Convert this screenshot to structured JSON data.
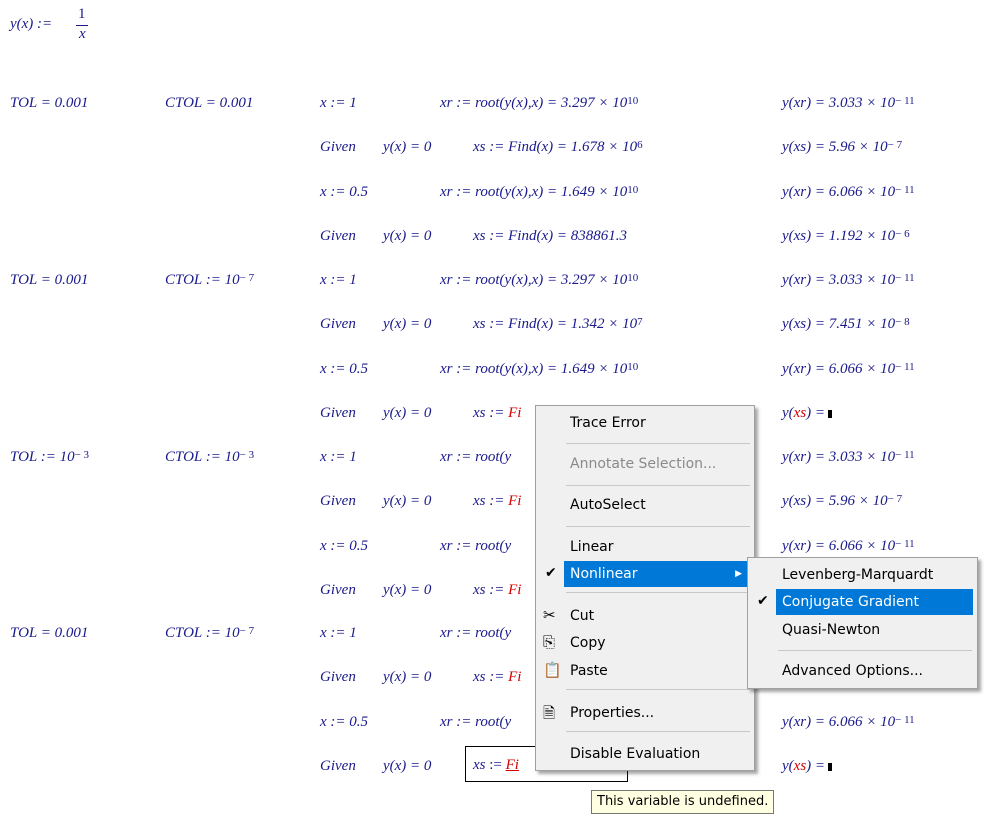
{
  "definition": {
    "lhs": "y(x) :=",
    "numerator": "1",
    "denominator": "x"
  },
  "blocks": [
    {
      "tol": "TOL = 0.001",
      "ctol": "CTOL = 0.001",
      "rows": [
        {
          "a": "x := 1",
          "b": "xr := root(y(x),x) = 3.297 × 10",
          "b_exp": "10",
          "c": "y(xr) = 3.033 × 10",
          "c_exp": "− 11"
        },
        {
          "a": "Given",
          "a2": "y(x) = 0",
          "b": "xs := Find(x) = 1.678 × 10",
          "b_exp": "6",
          "c": "y(xs) = 5.96 × 10",
          "c_exp": "− 7"
        },
        {
          "a": "x := 0.5",
          "b": "xr := root(y(x),x) = 1.649 × 10",
          "b_exp": "10",
          "c": "y(xr) = 6.066 × 10",
          "c_exp": "− 11"
        },
        {
          "a": "Given",
          "a2": "y(x) = 0",
          "b": "xs := Find(x) = 838861.3",
          "b_exp": "",
          "c": "y(xs) = 1.192 × 10",
          "c_exp": "− 6"
        }
      ]
    },
    {
      "tol": "TOL = 0.001",
      "ctol": "CTOL := 10",
      "ctol_exp": "− 7",
      "rows": [
        {
          "a": "x := 1",
          "b": "xr := root(y(x),x) = 3.297 × 10",
          "b_exp": "10",
          "c": "y(xr) = 3.033 × 10",
          "c_exp": "− 11"
        },
        {
          "a": "Given",
          "a2": "y(x) = 0",
          "b": "xs := Find(x) = 1.342 × 10",
          "b_exp": "7",
          "c": "y(xs) = 7.451 × 10",
          "c_exp": "− 8"
        },
        {
          "a": "x := 0.5",
          "b": "xr := root(y(x),x) = 1.649 × 10",
          "b_exp": "10",
          "c": "y(xr) = 6.066 × 10",
          "c_exp": "− 11"
        },
        {
          "a": "Given",
          "a2": "y(x) = 0",
          "b": "xs := Fi",
          "b_exp": "",
          "c": "y(xs) =",
          "c_exp": ""
        }
      ]
    },
    {
      "tol": "TOL := 10",
      "tol_exp": "− 3",
      "ctol": "CTOL := 10",
      "ctol_exp": "− 3",
      "rows": [
        {
          "a": "x := 1",
          "b": "xr := root(y",
          "b_exp": "",
          "c": "y(xr) = 3.033 × 10",
          "c_exp": "− 11"
        },
        {
          "a": "Given",
          "a2": "y(x) = 0",
          "b": "xs := Fi",
          "b_exp": "",
          "c": "y(xs) = 5.96 × 10",
          "c_exp": "− 7"
        },
        {
          "a": "x := 0.5",
          "b": "xr := root(y",
          "b_exp": "",
          "c": "y(xr) = 6.066 × 10",
          "c_exp": "− 11"
        },
        {
          "a": "Given",
          "a2": "y(x) = 0",
          "b": "xs := Fi",
          "b_exp": "",
          "c": "",
          "c_exp": ""
        }
      ]
    },
    {
      "tol": "TOL = 0.001",
      "ctol": "CTOL := 10",
      "ctol_exp": "− 7",
      "rows": [
        {
          "a": "x := 1",
          "b": "xr := root(y",
          "b_exp": "",
          "c": "",
          "c_exp": ""
        },
        {
          "a": "Given",
          "a2": "y(x) = 0",
          "b": "xs := Fi",
          "b_exp": "",
          "c": "",
          "c_exp": ""
        },
        {
          "a": "x := 0.5",
          "b": "xr := root(y",
          "b_exp": "",
          "c": "y(xr) = 6.066 × 10",
          "c_exp": "− 11"
        },
        {
          "a": "Given",
          "a2": "y(x) = 0",
          "b": "xs := Fi",
          "b_exp": "",
          "c": "y(xs) =",
          "c_exp": ""
        }
      ]
    }
  ],
  "context_menu": {
    "items": [
      {
        "label": "Trace Error",
        "mnemonic": "T"
      },
      {
        "label": "Annotate Selection...",
        "disabled": true
      },
      {
        "label": "AutoSelect",
        "mnemonic": "A"
      },
      {
        "label": "Linear",
        "mnemonic": "L"
      },
      {
        "label": "Nonlinear",
        "mnemonic": "N",
        "checked": true,
        "highlighted": true,
        "submenu": true
      },
      {
        "label": "Cut",
        "icon": "scissors-icon"
      },
      {
        "label": "Copy",
        "icon": "copy-icon"
      },
      {
        "label": "Paste",
        "icon": "paste-icon"
      },
      {
        "label": "Properties...",
        "icon": "properties-icon"
      },
      {
        "label": "Disable Evaluation",
        "mnemonic": "E"
      }
    ]
  },
  "submenu": {
    "items": [
      {
        "label": "Levenberg-Marquardt"
      },
      {
        "label": "Conjugate Gradient",
        "checked": true,
        "highlighted": true
      },
      {
        "label": "Quasi-Newton"
      },
      {
        "label": "Advanced Options..."
      }
    ]
  },
  "tooltip": "This variable is undefined.",
  "colors": {
    "math": "#1a1a8c",
    "error": "#d40000",
    "highlight": "#0078d7",
    "menu_bg": "#f0f0f0",
    "tooltip_bg": "#ffffe1"
  }
}
